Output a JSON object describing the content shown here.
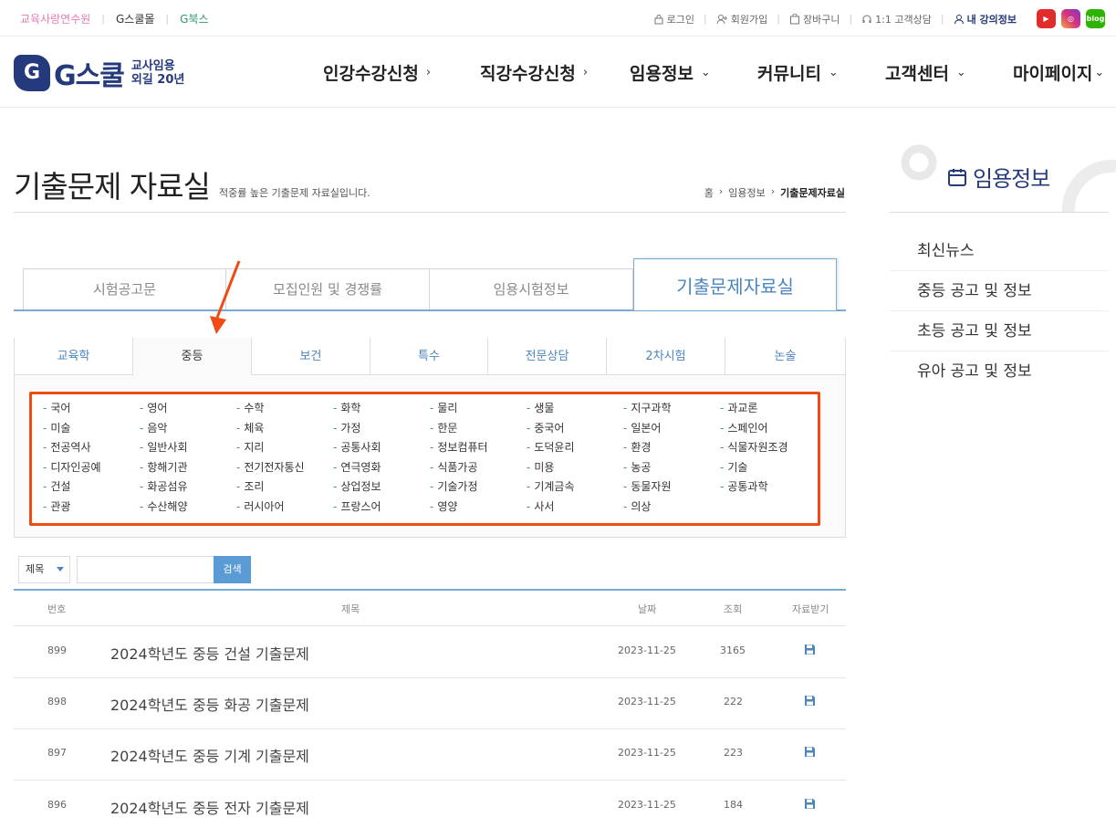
{
  "topbar": {
    "left_links": [
      {
        "label": "교육사랑연수원",
        "color": "#e57ab6"
      },
      {
        "label": "G스쿨몰",
        "color": "#333333"
      },
      {
        "label": "G북스",
        "color": "#2a9a6a"
      }
    ],
    "login": "로그인",
    "signup": "회원가입",
    "cart": "장바구니",
    "consult": "1:1 고객상담",
    "my_lecture": "내 강의정보",
    "social": [
      {
        "name": "youtube-icon",
        "color": "#e22b2b",
        "glyph": "▶"
      },
      {
        "name": "instagram-icon",
        "color": "#d6327f",
        "glyph": "◎"
      },
      {
        "name": "blog-icon",
        "color": "#2db400",
        "glyph": "blog"
      }
    ]
  },
  "header": {
    "logo_mark": "G",
    "logo_text": "G스쿨",
    "logo_sub1": "교사임용",
    "logo_sub2": "외길 20년",
    "nav": [
      {
        "label": "인강수강신청",
        "chev": "›"
      },
      {
        "label": "직강수강신청",
        "chev": "›"
      },
      {
        "label": "임용정보",
        "chev": "⌄"
      },
      {
        "label": "커뮤니티",
        "chev": "⌄"
      },
      {
        "label": "고객센터",
        "chev": "⌄"
      },
      {
        "label": "마이페이지",
        "chev": "⌄"
      }
    ]
  },
  "page": {
    "title": "기출문제 자료실",
    "subtitle": "적중률 높은 기출문제 자료실입니다.",
    "breadcrumb": [
      "홈",
      "임용정보",
      "기출문제자료실"
    ]
  },
  "main_tabs": [
    "시험공고문",
    "모집인원 및 경쟁률",
    "임용시험정보",
    "기출문제자료실"
  ],
  "main_tab_active": 3,
  "sub_tabs": [
    "교육학",
    "중등",
    "보건",
    "특수",
    "전문상담",
    "2차시험",
    "논술"
  ],
  "sub_tab_active": 1,
  "subjects": [
    [
      "국어",
      "영어",
      "수학",
      "화학",
      "물리",
      "생물",
      "지구과학",
      "과교론"
    ],
    [
      "미술",
      "음악",
      "체육",
      "가정",
      "한문",
      "중국어",
      "일본어",
      "스페인어"
    ],
    [
      "전공역사",
      "일반사회",
      "지리",
      "공통사회",
      "정보컴퓨터",
      "도덕윤리",
      "환경",
      "식물자원조경"
    ],
    [
      "디자인공예",
      "항해기관",
      "전기전자통신",
      "연극영화",
      "식품가공",
      "미용",
      "농공",
      "기술"
    ],
    [
      "건설",
      "화공섬유",
      "조리",
      "상업정보",
      "기술가정",
      "기계금속",
      "동물자원",
      "공통과학"
    ],
    [
      "관광",
      "수산해양",
      "러시아어",
      "프랑스어",
      "영양",
      "사서",
      "의상"
    ]
  ],
  "search": {
    "select_value": "제목",
    "input_value": "",
    "button": "검색"
  },
  "table": {
    "headers": [
      "번호",
      "제목",
      "날짜",
      "조회",
      "자료받기"
    ],
    "rows": [
      {
        "no": "899",
        "title": "2024학년도 중등 건설 기출문제",
        "date": "2023-11-25",
        "views": "3165"
      },
      {
        "no": "898",
        "title": "2024학년도 중등 화공 기출문제",
        "date": "2023-11-25",
        "views": "222"
      },
      {
        "no": "897",
        "title": "2024학년도 중등 기계 기출문제",
        "date": "2023-11-25",
        "views": "223"
      },
      {
        "no": "896",
        "title": "2024학년도 중등 전자 기출문제",
        "date": "2023-11-25",
        "views": "184"
      }
    ]
  },
  "sidebar": {
    "title": "임용정보",
    "items": [
      "최신뉴스",
      "중등 공고 및 정보",
      "초등 공고 및 정보",
      "유아 공고 및 정보"
    ]
  },
  "colors": {
    "accent": "#4a86c0",
    "brand": "#253a7c",
    "highlight": "#ef4b12"
  }
}
